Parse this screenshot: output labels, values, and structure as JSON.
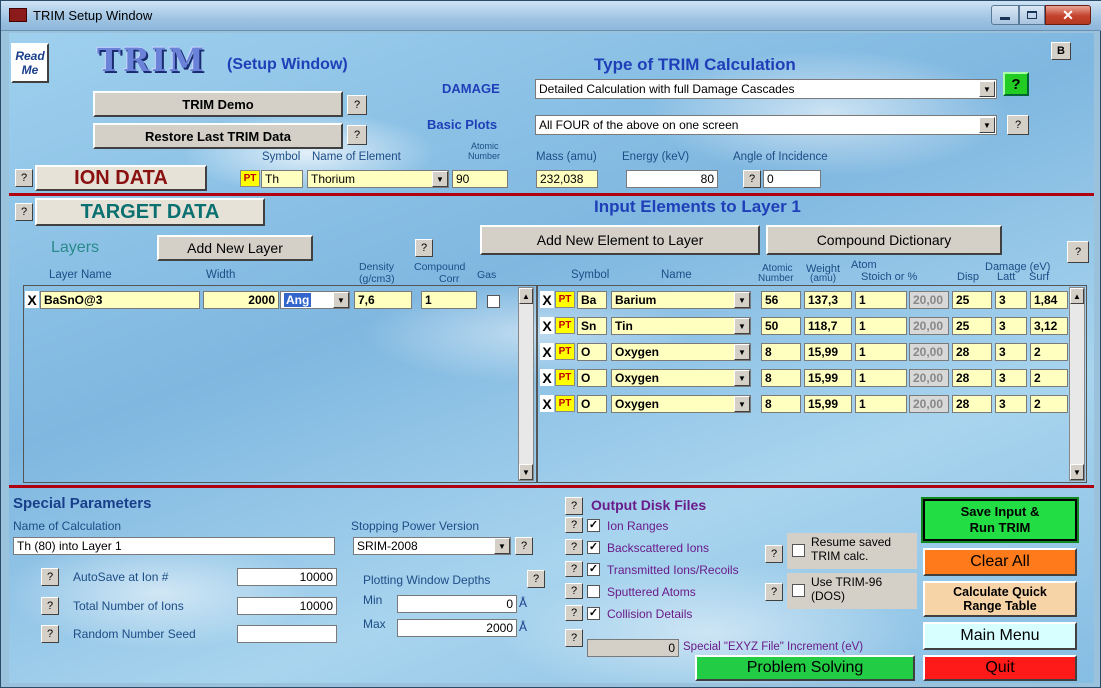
{
  "window": {
    "title": "TRIM Setup Window"
  },
  "header": {
    "read_me": "Read Me",
    "logo": "TRIM",
    "subtitle": "(Setup Window)",
    "b_button": "B",
    "trim_demo": "TRIM Demo",
    "restore": "Restore Last TRIM Data",
    "help": "?"
  },
  "calc": {
    "title": "Type of TRIM Calculation",
    "damage_label": "DAMAGE",
    "damage_value": "Detailed Calculation with full Damage Cascades",
    "plots_label": "Basic Plots",
    "plots_value": "All FOUR of the above on one screen"
  },
  "ion": {
    "section": "ION DATA",
    "hdr_symbol": "Symbol",
    "hdr_name": "Name of Element",
    "hdr_atomic_1": "Atomic",
    "hdr_atomic_2": "Number",
    "hdr_mass": "Mass (amu)",
    "hdr_energy": "Energy (keV)",
    "hdr_angle": "Angle of Incidence",
    "pt": "PT",
    "symbol": "Th",
    "name": "Thorium",
    "atomic": "90",
    "mass": "232,038",
    "energy": "80",
    "angle": "0"
  },
  "target": {
    "section": "TARGET DATA",
    "input_title": "Input Elements to Layer 1",
    "layers_label": "Layers",
    "add_layer": "Add New Layer",
    "add_element": "Add New Element to Layer",
    "compound_dict": "Compound Dictionary",
    "layer_hdr": {
      "name": "Layer Name",
      "width": "Width",
      "density_1": "Density",
      "density_2": "(g/cm3)",
      "compound_1": "Compound",
      "compound_2": "Corr",
      "gas": "Gas"
    },
    "layer": {
      "x": "X",
      "name": "BaSnO@3",
      "width": "2000",
      "unit": "Ang",
      "density": "7,6",
      "corr": "1"
    },
    "elem_hdr": {
      "symbol": "Symbol",
      "name": "Name",
      "atomic_1": "Atomic",
      "atomic_2": "Number",
      "weight_1": "Weight",
      "weight_2": "(amu)",
      "atom_1": "Atom",
      "atom_2": "Stoich or %",
      "damage": "Damage (eV)",
      "disp": "Disp",
      "latt": "Latt",
      "surf": "Surf"
    },
    "elements": [
      {
        "x": "X",
        "pt": "PT",
        "symbol": "Ba",
        "name": "Barium",
        "atomic": "56",
        "weight": "137,3",
        "stoich": "1",
        "pct": "20,00",
        "disp": "25",
        "latt": "3",
        "surf": "1,84"
      },
      {
        "x": "X",
        "pt": "PT",
        "symbol": "Sn",
        "name": "Tin",
        "atomic": "50",
        "weight": "118,7",
        "stoich": "1",
        "pct": "20,00",
        "disp": "25",
        "latt": "3",
        "surf": "3,12"
      },
      {
        "x": "X",
        "pt": "PT",
        "symbol": "O",
        "name": "Oxygen",
        "atomic": "8",
        "weight": "15,99",
        "stoich": "1",
        "pct": "20,00",
        "disp": "28",
        "latt": "3",
        "surf": "2"
      },
      {
        "x": "X",
        "pt": "PT",
        "symbol": "O",
        "name": "Oxygen",
        "atomic": "8",
        "weight": "15,99",
        "stoich": "1",
        "pct": "20,00",
        "disp": "28",
        "latt": "3",
        "surf": "2"
      },
      {
        "x": "X",
        "pt": "PT",
        "symbol": "O",
        "name": "Oxygen",
        "atomic": "8",
        "weight": "15,99",
        "stoich": "1",
        "pct": "20,00",
        "disp": "28",
        "latt": "3",
        "surf": "2"
      }
    ]
  },
  "special": {
    "title": "Special Parameters",
    "name_label": "Name of Calculation",
    "name_value": "Th (80) into Layer 1",
    "sp_label": "Stopping Power Version",
    "sp_value": "SRIM-2008",
    "autosave_label": "AutoSave at Ion #",
    "autosave_value": "10000",
    "total_label": "Total Number of Ions",
    "total_value": "10000",
    "seed_label": "Random Number Seed",
    "seed_value": "",
    "plot_depth_label": "Plotting Window Depths",
    "min_label": "Min",
    "min_value": "0",
    "max_label": "Max",
    "max_value": "2000",
    "unit": "Å"
  },
  "output": {
    "title": "Output Disk Files",
    "items": [
      {
        "label": "Ion Ranges",
        "checked": "✓"
      },
      {
        "label": "Backscattered Ions",
        "checked": "✓"
      },
      {
        "label": "Transmitted Ions/Recoils",
        "checked": "✓"
      },
      {
        "label": "Sputtered Atoms",
        "checked": ""
      },
      {
        "label": "Collision Details",
        "checked": "✓"
      }
    ],
    "resume_1": "Resume saved",
    "resume_2": "TRIM calc.",
    "trim96_1": "Use TRIM-96",
    "trim96_2": "(DOS)",
    "exyz_value": "0",
    "exyz_label": "Special \"EXYZ File\" Increment (eV)"
  },
  "actions": {
    "save_run_1": "Save Input &",
    "save_run_2": "Run TRIM",
    "clear_all": "Clear All",
    "quick_1": "Calculate Quick",
    "quick_2": "Range Table",
    "main_menu": "Main Menu",
    "problem_solving": "Problem Solving",
    "quit": "Quit"
  }
}
